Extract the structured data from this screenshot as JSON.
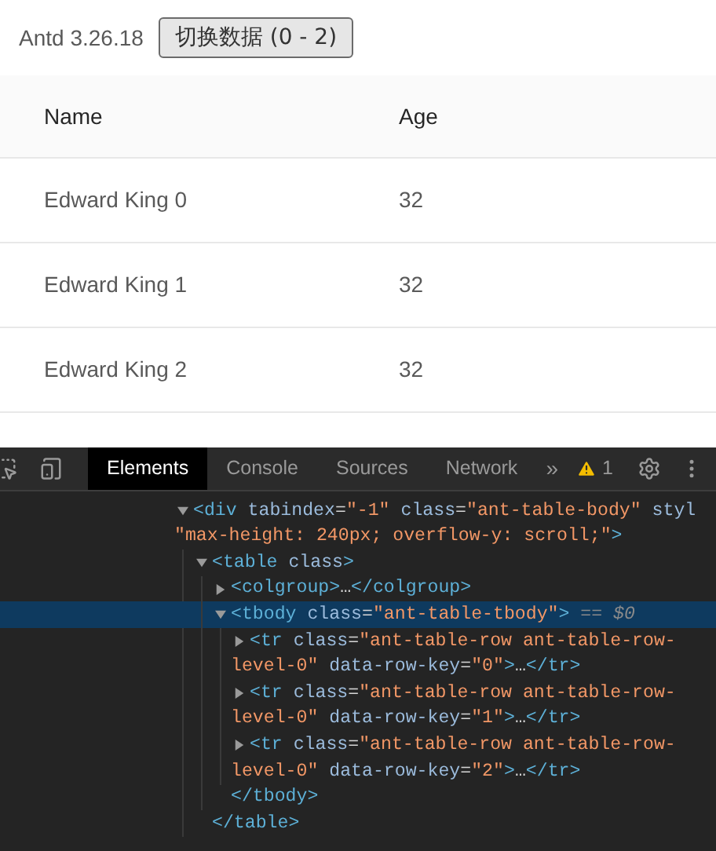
{
  "header": {
    "version": "Antd 3.26.18",
    "toggle_button": "切换数据 (0 - 2)"
  },
  "table": {
    "columns": [
      "Name",
      "Age"
    ],
    "rows": [
      [
        "Edward King 0",
        "32"
      ],
      [
        "Edward King 1",
        "32"
      ],
      [
        "Edward King 2",
        "32"
      ]
    ]
  },
  "devtools": {
    "tabs": [
      {
        "label": "Elements",
        "selected": true
      },
      {
        "label": "Console",
        "selected": false
      },
      {
        "label": "Sources",
        "selected": false
      },
      {
        "label": "Network",
        "selected": false
      }
    ],
    "more": "»",
    "warning_count": "1",
    "dom": [
      {
        "expanded": true,
        "selected": false,
        "lines": [
          [
            {
              "kind": "tag",
              "text": "<div"
            },
            {
              "kind": "attr",
              "text": " tabindex"
            },
            {
              "kind": "text",
              "text": "="
            },
            {
              "kind": "value",
              "text": "\"-1\""
            },
            {
              "kind": "attr",
              "text": " class"
            },
            {
              "kind": "text",
              "text": "="
            },
            {
              "kind": "value",
              "text": "\"ant-table-body\""
            },
            {
              "kind": "attr",
              "text": " styl"
            }
          ],
          [
            {
              "kind": "value",
              "text": "\"max-height: 240px; overflow-y: scroll;\""
            },
            {
              "kind": "tag",
              "text": ">"
            }
          ]
        ],
        "children": [
          {
            "expanded": true,
            "selected": false,
            "lines": [
              [
                {
                  "kind": "tag",
                  "text": "<table"
                },
                {
                  "kind": "attr",
                  "text": " class"
                },
                {
                  "kind": "tag",
                  "text": ">"
                }
              ]
            ],
            "children": [
              {
                "expanded": false,
                "selected": false,
                "lines": [
                  [
                    {
                      "kind": "tag",
                      "text": "<colgroup>"
                    },
                    {
                      "kind": "text",
                      "text": "…"
                    },
                    {
                      "kind": "tag",
                      "text": "</colgroup>"
                    }
                  ]
                ]
              },
              {
                "expanded": true,
                "selected": true,
                "lines": [
                  [
                    {
                      "kind": "tag",
                      "text": "<tbody"
                    },
                    {
                      "kind": "attr",
                      "text": " class"
                    },
                    {
                      "kind": "text",
                      "text": "="
                    },
                    {
                      "kind": "value",
                      "text": "\"ant-table-tbody\""
                    },
                    {
                      "kind": "tag",
                      "text": ">"
                    },
                    {
                      "kind": "marker",
                      "text": " == $0"
                    }
                  ]
                ],
                "children": [
                  {
                    "expanded": false,
                    "selected": false,
                    "lines": [
                      [
                        {
                          "kind": "tag",
                          "text": "<tr"
                        },
                        {
                          "kind": "attr",
                          "text": " class"
                        },
                        {
                          "kind": "text",
                          "text": "="
                        },
                        {
                          "kind": "value",
                          "text": "\"ant-table-row ant-table-row-"
                        }
                      ],
                      [
                        {
                          "kind": "value",
                          "text": "level-0\""
                        },
                        {
                          "kind": "attr",
                          "text": " data-row-key"
                        },
                        {
                          "kind": "text",
                          "text": "="
                        },
                        {
                          "kind": "value",
                          "text": "\"0\""
                        },
                        {
                          "kind": "tag",
                          "text": ">"
                        },
                        {
                          "kind": "text",
                          "text": "…"
                        },
                        {
                          "kind": "tag",
                          "text": "</tr>"
                        }
                      ]
                    ]
                  },
                  {
                    "expanded": false,
                    "selected": false,
                    "lines": [
                      [
                        {
                          "kind": "tag",
                          "text": "<tr"
                        },
                        {
                          "kind": "attr",
                          "text": " class"
                        },
                        {
                          "kind": "text",
                          "text": "="
                        },
                        {
                          "kind": "value",
                          "text": "\"ant-table-row ant-table-row-"
                        }
                      ],
                      [
                        {
                          "kind": "value",
                          "text": "level-0\""
                        },
                        {
                          "kind": "attr",
                          "text": " data-row-key"
                        },
                        {
                          "kind": "text",
                          "text": "="
                        },
                        {
                          "kind": "value",
                          "text": "\"1\""
                        },
                        {
                          "kind": "tag",
                          "text": ">"
                        },
                        {
                          "kind": "text",
                          "text": "…"
                        },
                        {
                          "kind": "tag",
                          "text": "</tr>"
                        }
                      ]
                    ]
                  },
                  {
                    "expanded": false,
                    "selected": false,
                    "lines": [
                      [
                        {
                          "kind": "tag",
                          "text": "<tr"
                        },
                        {
                          "kind": "attr",
                          "text": " class"
                        },
                        {
                          "kind": "text",
                          "text": "="
                        },
                        {
                          "kind": "value",
                          "text": "\"ant-table-row ant-table-row-"
                        }
                      ],
                      [
                        {
                          "kind": "value",
                          "text": "level-0\""
                        },
                        {
                          "kind": "attr",
                          "text": " data-row-key"
                        },
                        {
                          "kind": "text",
                          "text": "="
                        },
                        {
                          "kind": "value",
                          "text": "\"2\""
                        },
                        {
                          "kind": "tag",
                          "text": ">"
                        },
                        {
                          "kind": "text",
                          "text": "…"
                        },
                        {
                          "kind": "tag",
                          "text": "</tr>"
                        }
                      ]
                    ]
                  }
                ],
                "closing": [
                  {
                    "kind": "tag",
                    "text": "</tbody>"
                  }
                ]
              }
            ],
            "closing": [
              {
                "kind": "tag",
                "text": "</table>"
              }
            ]
          }
        ]
      }
    ]
  }
}
